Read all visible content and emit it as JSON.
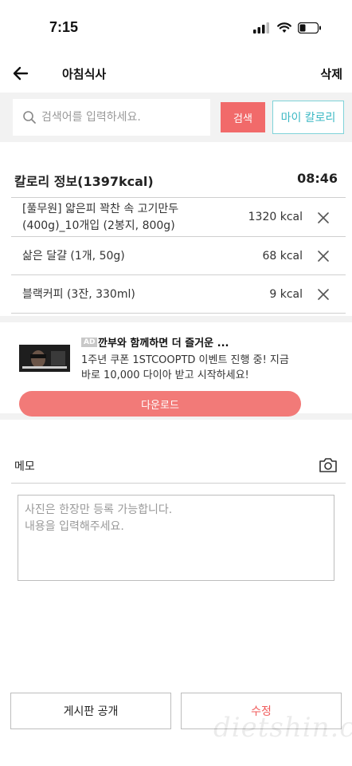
{
  "status_bar": {
    "time": "7:15"
  },
  "nav": {
    "title": "아침식사",
    "delete_label": "삭제"
  },
  "search": {
    "placeholder": "검색어를 입력하세요.",
    "button_label": "검색",
    "my_calorie_label": "마이 칼로리"
  },
  "calorie": {
    "header": "칼로리 정보(1397kcal)",
    "time": "08:46",
    "items": [
      {
        "name_line1": "[풀무원] 얇은피 꽉찬 속 고기만두",
        "name_line2": "(400g)_10개입 (2봉지, 800g)",
        "kcal": "1320 kcal"
      },
      {
        "name_line1": "삶은 달걀 (1개, 50g)",
        "name_line2": "",
        "kcal": "68 kcal"
      },
      {
        "name_line1": "블랙커피 (3잔, 330ml)",
        "name_line2": "",
        "kcal": "9 kcal"
      }
    ]
  },
  "ad": {
    "badge": "AD",
    "title": "깐부와 함께하면 더 즐거운 ...",
    "desc_line1": "1주년 쿠폰 1STCOOPTD 이벤트 진행 중! 지금",
    "desc_line2": "바로 10,000 다이아 받고 시작하세요!",
    "download_label": "다운로드"
  },
  "memo": {
    "label": "메모",
    "placeholder": "사진은 한장만 등록 가능합니다.\n내용을 입력해주세요."
  },
  "footer": {
    "board_label": "게시판 공개",
    "edit_label": "수정"
  },
  "watermark": "dietshin.com",
  "colors": {
    "accent_red": "#f16a6a",
    "accent_cyan": "#3bb8c4",
    "background_gray": "#f2f2f2"
  },
  "icons": {
    "back": "arrow-left-icon",
    "search": "search-icon",
    "delete_item": "close-icon",
    "camera": "camera-icon"
  }
}
